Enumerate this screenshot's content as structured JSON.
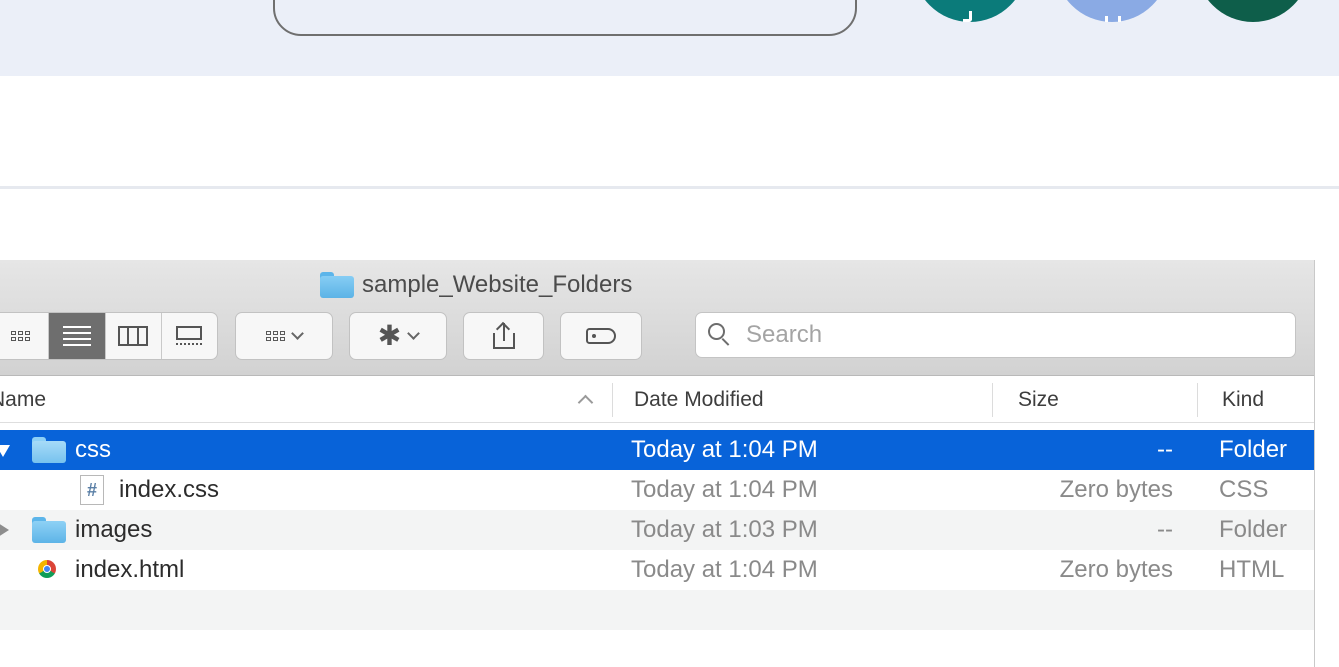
{
  "finder": {
    "title": "sample_Website_Folders",
    "search": {
      "placeholder": "Search"
    },
    "columns": {
      "name": "Name",
      "date": "Date Modified",
      "size": "Size",
      "kind": "Kind"
    },
    "rows": [
      {
        "name": "css",
        "date": "Today at 1:04 PM",
        "size": "--",
        "kind": "Folder"
      },
      {
        "name": "index.css",
        "date": "Today at 1:04 PM",
        "size": "Zero bytes",
        "kind": "CSS"
      },
      {
        "name": "images",
        "date": "Today at 1:03 PM",
        "size": "--",
        "kind": "Folder"
      },
      {
        "name": "index.html",
        "date": "Today at 1:04 PM",
        "size": "Zero bytes",
        "kind": "HTML"
      }
    ],
    "toolbar_icons": {
      "icon_view": "grid-icon",
      "list_view": "list-icon",
      "column_view": "columns-icon",
      "gallery_view": "cover-flow-icon",
      "arrange": "arrange-grid-icon",
      "action": "gear-icon",
      "share": "share-icon",
      "tags": "tag-icon"
    }
  },
  "colors": {
    "selection": "#0863d9",
    "banner_bg": "#ebeff8",
    "folder": "#5cb5ea"
  }
}
